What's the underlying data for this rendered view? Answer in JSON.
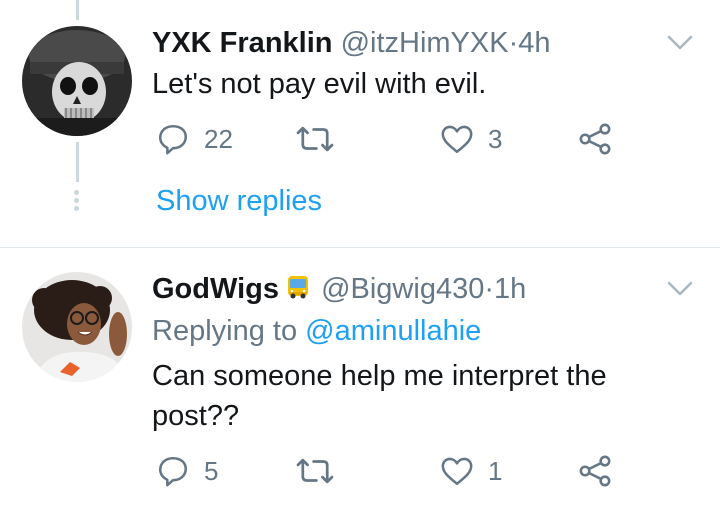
{
  "tweet1": {
    "display_name": "YXK Franklin",
    "handle": "@itzHimYXK",
    "separator": "·",
    "time": "4h",
    "text": "Let's not pay evil with evil.",
    "reply_count": "22",
    "retweet_count": "",
    "like_count": "3",
    "show_replies": "Show replies"
  },
  "tweet2": {
    "display_name": "GodWigs",
    "handle": "@Bigwig430",
    "separator": "·",
    "time": "1h",
    "replying_prefix": "Replying to",
    "replying_to": "@aminullahie",
    "text": "Can someone help me interpret the post??",
    "reply_count": "5",
    "retweet_count": "",
    "like_count": "1"
  },
  "colors": {
    "link_blue": "#1da1f2",
    "secondary_gray": "#657786",
    "divider": "#e1e8ed"
  },
  "icons": [
    "reply-icon",
    "retweet-icon",
    "like-icon",
    "share-icon",
    "chevron-down-icon",
    "bus-emoji-icon"
  ]
}
